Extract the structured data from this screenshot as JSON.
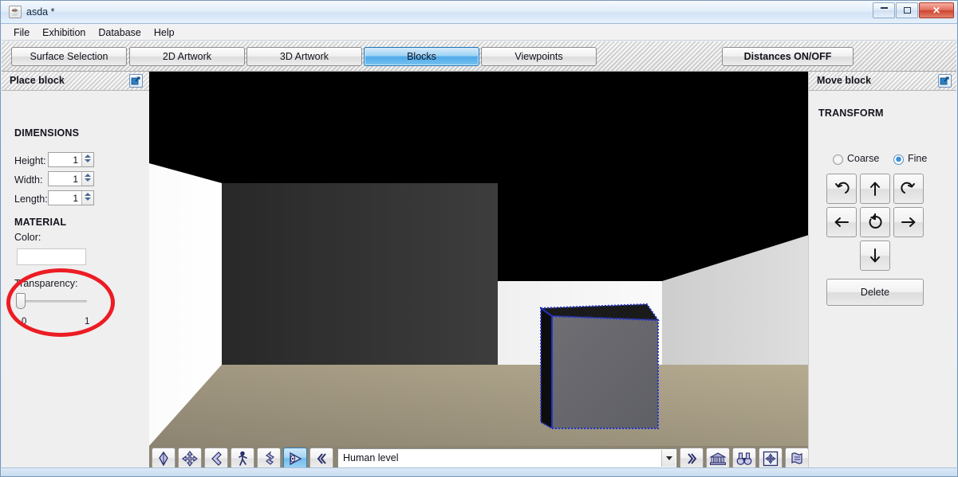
{
  "window": {
    "title": "asda *",
    "app_icon": "java-coffee-icon",
    "controls": {
      "minimize": "minimize-icon",
      "maximize": "maximize-icon",
      "close": "✕"
    }
  },
  "menubar": {
    "items": [
      "File",
      "Exhibition",
      "Database",
      "Help"
    ]
  },
  "toolbar": {
    "tabs": [
      {
        "label": "Surface Selection",
        "active": false,
        "bold": false
      },
      {
        "label": "2D Artwork",
        "active": false,
        "bold": false
      },
      {
        "label": "3D Artwork",
        "active": false,
        "bold": false
      },
      {
        "label": "Blocks",
        "active": true,
        "bold": false
      },
      {
        "label": "Viewpoints",
        "active": false,
        "bold": false
      }
    ],
    "distances_button": {
      "label": "Distances ON/OFF",
      "bold": true
    }
  },
  "left_panel": {
    "title": "Place block",
    "undock_icon": "undock-window-icon",
    "dimensions": {
      "heading": "DIMENSIONS",
      "fields": [
        {
          "label": "Height:",
          "value": "1"
        },
        {
          "label": "Width:",
          "value": "1"
        },
        {
          "label": "Length:",
          "value": "1"
        }
      ]
    },
    "material": {
      "heading": "MATERIAL",
      "color_label": "Color:",
      "color_value": "#ffffff",
      "transparency_label": "Transparency:",
      "transparency_min": "0",
      "transparency_max": "1",
      "transparency_value": 0
    },
    "annotation": {
      "shape": "red-ellipse",
      "color": "#ec1c24",
      "highlights": "transparency-slider"
    }
  },
  "right_panel": {
    "title": "Move block",
    "undock_icon": "undock-window-icon",
    "transform_heading": "TRANSFORM",
    "mode": {
      "options": [
        {
          "label": "Coarse",
          "selected": false
        },
        {
          "label": "Fine",
          "selected": true
        }
      ]
    },
    "arrow_buttons": [
      {
        "name": "rotate-left-button",
        "glyph": "↶"
      },
      {
        "name": "move-up-button",
        "glyph": "↑"
      },
      {
        "name": "rotate-right-button",
        "glyph": "↷"
      },
      {
        "name": "move-left-button",
        "glyph": "←"
      },
      {
        "name": "rotate-button",
        "glyph": "↻"
      },
      {
        "name": "move-right-button",
        "glyph": "→"
      },
      {
        "name": "move-down-button",
        "glyph": "↓"
      }
    ],
    "delete_button": "Delete"
  },
  "viewport": {
    "scene": "3d-gallery-room",
    "ceiling_color": "#000000",
    "left_wall_color": "#fdfdfd",
    "back_wall_color": "#313131",
    "back_right_wall_color": "#f4f4f4",
    "right_wall_color": "#d4d4d4",
    "floor_color": "#8e8571",
    "block": {
      "front_face_color": "#6b6b70",
      "side_face_color": "#0d0d0d",
      "selection_outline_color": "#2233cc",
      "selected": true
    }
  },
  "bottom_toolbar": {
    "left_buttons": [
      {
        "name": "place-tool-button",
        "icon": "diamond-arrow-icon",
        "selected": false
      },
      {
        "name": "move-tool-button",
        "icon": "four-arrows-icon",
        "selected": false
      },
      {
        "name": "back-tool-button",
        "icon": "left-chevron-icon",
        "selected": false
      },
      {
        "name": "walk-tool-button",
        "icon": "walking-person-icon",
        "selected": false
      },
      {
        "name": "rotate-tool-button",
        "icon": "twisted-arrow-icon",
        "selected": false
      },
      {
        "name": "view-tool-button",
        "icon": "eye-cone-icon",
        "selected": true
      },
      {
        "name": "collapse-button",
        "icon": "double-left-chevron-icon",
        "selected": false
      }
    ],
    "viewpoint_combo": {
      "value": "Human level"
    },
    "right_buttons": [
      {
        "name": "expand-button",
        "icon": "double-right-chevron-icon"
      },
      {
        "name": "gallery-home-button",
        "icon": "museum-house-icon"
      },
      {
        "name": "binoculars-button",
        "icon": "binoculars-icon"
      },
      {
        "name": "fit-view-button",
        "icon": "four-arrows-box-icon"
      },
      {
        "name": "scroll-report-button",
        "icon": "scroll-icon"
      }
    ]
  }
}
